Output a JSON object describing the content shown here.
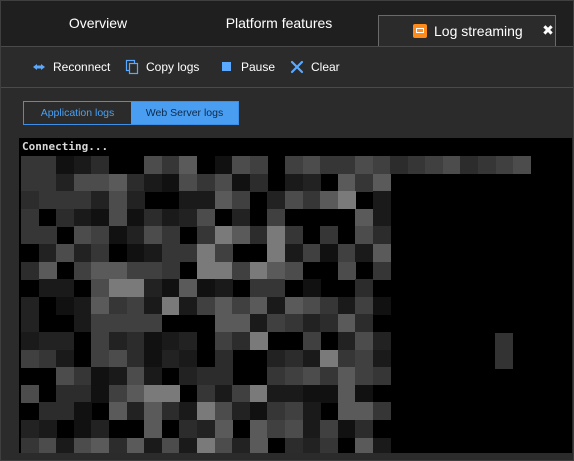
{
  "tabs": {
    "overview": "Overview",
    "platform": "Platform features",
    "active": "Log streaming"
  },
  "icons": {
    "tab": "log-stream-icon",
    "close": "close-icon",
    "reconnect": "reconnect-icon",
    "copy": "copy-icon",
    "pause": "pause-icon",
    "clear": "clear-icon"
  },
  "toolbar": {
    "reconnect": "Reconnect",
    "copy": "Copy logs",
    "pause": "Pause",
    "clear": "Clear"
  },
  "log_type": {
    "application": "Application logs",
    "web_server": "Web Server logs",
    "selected": "Web Server logs"
  },
  "console": {
    "status": "Connecting..."
  },
  "colors": {
    "accent": "#4a9ef2",
    "tab_icon": "#ff8c1a",
    "background": "#2b2b2b",
    "console_background": "#000000"
  }
}
